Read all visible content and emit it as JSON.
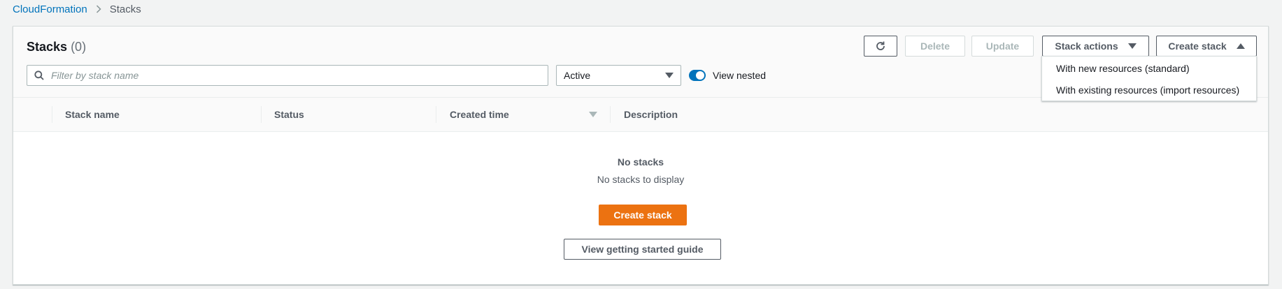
{
  "breadcrumb": {
    "items": [
      "CloudFormation",
      "Stacks"
    ]
  },
  "header": {
    "title": "Stacks",
    "count": "(0)"
  },
  "toolbar": {
    "refresh_icon": "refresh-icon",
    "delete_label": "Delete",
    "update_label": "Update",
    "stack_actions_label": "Stack actions",
    "create_stack_label": "Create stack"
  },
  "filters": {
    "search_placeholder": "Filter by stack name",
    "search_value": "",
    "status_selected": "Active",
    "view_nested_label": "View nested",
    "view_nested_on": true
  },
  "table": {
    "columns": [
      "Stack name",
      "Status",
      "Created time",
      "Description"
    ],
    "sorted_column": "Created time",
    "rows": []
  },
  "empty_state": {
    "title": "No stacks",
    "text": "No stacks to display",
    "create_label": "Create stack",
    "guide_label": "View getting started guide"
  },
  "create_menu": {
    "items": [
      "With new resources (standard)",
      "With existing resources (import resources)"
    ]
  },
  "colors": {
    "primary": "#ec7211",
    "link": "#0073bb",
    "toggle": "#0073bb"
  }
}
